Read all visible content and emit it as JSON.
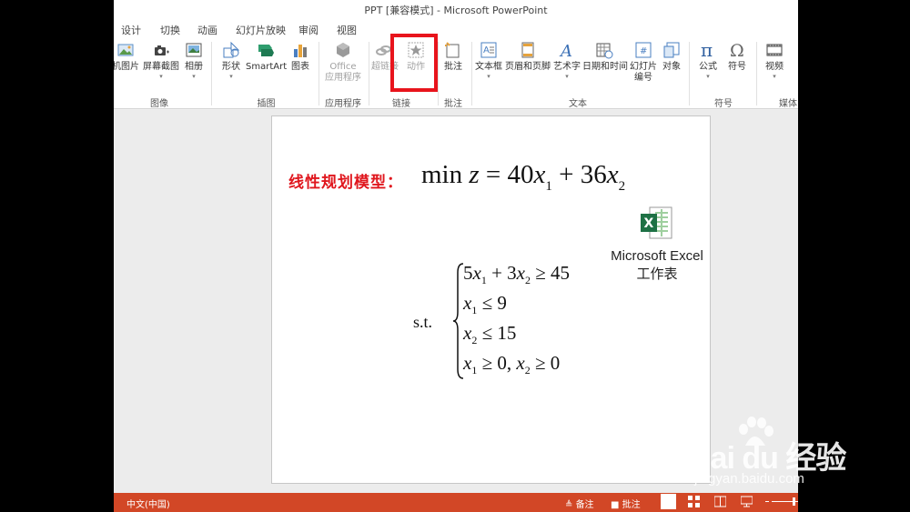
{
  "window": {
    "title": "PPT [兼容模式] - Microsoft PowerPoint"
  },
  "tabs": [
    "设计",
    "切换",
    "动画",
    "幻灯片放映",
    "审阅",
    "视图"
  ],
  "ribbon": {
    "buttons": {
      "online_images": "机图片",
      "screenshot": "屏幕截图",
      "album": "相册",
      "shapes": "形状",
      "smartart": "SmartArt",
      "chart": "图表",
      "office_apps_1": "Office",
      "office_apps_2": "应用程序",
      "hyperlink": "超链接",
      "action": "动作",
      "comment": "批注",
      "textbox": "文本框",
      "header_footer": "页眉和页脚",
      "wordart": "艺术字",
      "datetime": "日期和时间",
      "slide_number_1": "幻灯片",
      "slide_number_2": "编号",
      "object": "对象",
      "equation": "公式",
      "symbol": "符号",
      "video": "视频"
    },
    "groups": {
      "images": "图像",
      "illustrations": "插图",
      "apps": "应用程序",
      "links": "链接",
      "comments": "批注",
      "text": "文本",
      "symbols": "符号",
      "media": "媒体"
    }
  },
  "slide": {
    "label": "线性规划模型：",
    "objective": {
      "prefix": "min ",
      "var": "z",
      "eq": " = 40",
      "x1": "x",
      "sub1": "1",
      "plus": " + 36",
      "x2": "x",
      "sub2": "2"
    },
    "excel_object": {
      "line1": "Microsoft Excel",
      "line2": "工作表"
    },
    "st_label": "s.t.",
    "constraints": [
      {
        "a": "5",
        "x1": "x",
        "s1": "1",
        "mid": " + 3",
        "x2": "x",
        "s2": "2",
        "rhs": " ≥ 45"
      },
      {
        "x1": "x",
        "s1": "1",
        "rhs": " ≤ 9"
      },
      {
        "x2": "x",
        "s2": "2",
        "rhs": " ≤ 15"
      },
      {
        "x1": "x",
        "s1": "1",
        "mid": " ≥ 0, ",
        "x2": "x",
        "s2": "2",
        "rhs": " ≥ 0"
      }
    ]
  },
  "status": {
    "language": "中文(中国)",
    "notes": "备注",
    "comments": "批注"
  },
  "watermark": {
    "brand": "Bai du 经验",
    "url": "jingyan.baidu.com"
  },
  "colors": {
    "accent": "#d24726",
    "highlight": "#e8141c",
    "label_red": "#e0171e",
    "excel_green": "#1e7145"
  }
}
